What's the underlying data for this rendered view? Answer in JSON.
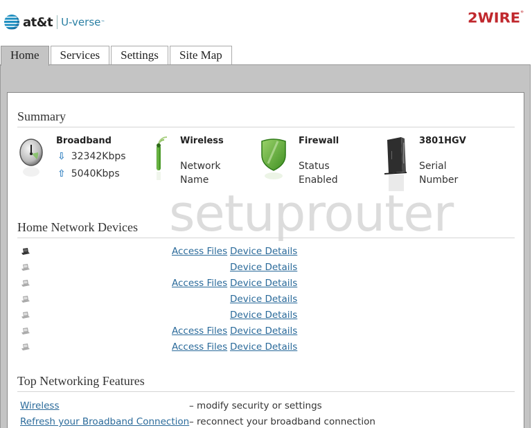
{
  "header": {
    "brand_left": "at&t",
    "brand_product": "U-verse",
    "brand_tm": "™",
    "brand_right": "2WIRE",
    "brand_right_mark": "®"
  },
  "tabs": [
    {
      "label": "Home",
      "active": true
    },
    {
      "label": "Services",
      "active": false
    },
    {
      "label": "Settings",
      "active": false
    },
    {
      "label": "Site Map",
      "active": false
    }
  ],
  "summary": {
    "title": "Summary",
    "broadband": {
      "title": "Broadband",
      "down_icon": "arrow-down-icon",
      "down_value": "32342Kbps",
      "up_icon": "arrow-up-icon",
      "up_value": "5040Kbps"
    },
    "wireless": {
      "title": "Wireless",
      "line1": "Network",
      "line2": "Name"
    },
    "firewall": {
      "title": "Firewall",
      "line1": "Status",
      "line2": "Enabled"
    },
    "device": {
      "title": "3801HGV",
      "line1": "Serial",
      "line2": "Number"
    }
  },
  "home_network": {
    "title": "Home Network Devices",
    "devices": [
      {
        "icon": "computer-icon",
        "active": true,
        "access_files": "Access Files",
        "device_details": "Device Details"
      },
      {
        "icon": "computer-icon",
        "active": false,
        "access_files": null,
        "device_details": "Device Details"
      },
      {
        "icon": "computer-icon",
        "active": false,
        "access_files": "Access Files",
        "device_details": "Device Details"
      },
      {
        "icon": "computer-icon",
        "active": false,
        "access_files": null,
        "device_details": "Device Details"
      },
      {
        "icon": "computer-icon",
        "active": false,
        "access_files": null,
        "device_details": "Device Details"
      },
      {
        "icon": "computer-icon",
        "active": false,
        "access_files": "Access Files",
        "device_details": "Device Details"
      },
      {
        "icon": "computer-icon",
        "active": false,
        "access_files": "Access Files",
        "device_details": "Device Details"
      }
    ]
  },
  "features": {
    "title": "Top Networking Features",
    "items": [
      {
        "link": "Wireless",
        "desc": "– modify security or settings"
      },
      {
        "link": "Refresh your Broadband Connection",
        "desc": "– reconnect your broadband connection"
      }
    ]
  },
  "watermark": "setuprouter",
  "colors": {
    "link": "#2a6a9a",
    "panel_gray": "#c4c4c4",
    "brand_red": "#c0282d",
    "brand_blue": "#2a7fa3",
    "status_green": "#5aa832"
  }
}
